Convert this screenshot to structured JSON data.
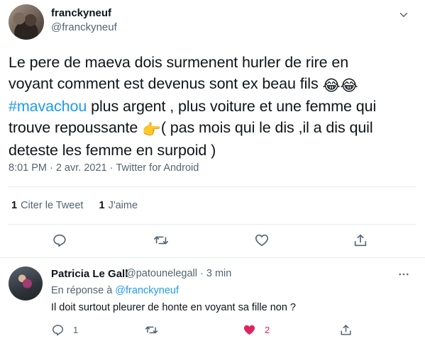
{
  "main_tweet": {
    "display_name": "franckyneuf",
    "handle": "@franckyneuf",
    "text_parts": {
      "line1": "Le pere de maeva dois surmenent hurler de rire en",
      "line2a": "voyant comment est devenus sont ex beau fils ",
      "emoji_laugh": "😂😂",
      "hashtag": "#mavachou",
      "line3b": " plus argent , plus voiture et une femme qui",
      "line4a": "trouve repoussante ",
      "emoji_point": "👉",
      "line4b": "( pas mois qui le dis ,il a dis quil",
      "line5": "deteste les femme en surpoid )"
    },
    "time": "8:01 PM",
    "date": "2 avr. 2021",
    "source": "Twitter for Android",
    "stats": {
      "retweets_count": "1",
      "retweets_label": "Citer le Tweet",
      "likes_count": "1",
      "likes_label": "J'aime"
    }
  },
  "reply": {
    "display_name": "Patricia Le Gall",
    "handle": "@patounelegall · 3 min",
    "replying_prefix": "En réponse à",
    "replying_to": "@franckyneuf",
    "text": "Il doit surtout pleurer de honte en voyant sa fille non ?",
    "reply_count": "1",
    "like_count": "2"
  },
  "icons": {
    "more": "chevron-down-icon",
    "reply": "reply-icon",
    "retweet": "retweet-icon",
    "like": "heart-icon",
    "share": "share-icon"
  },
  "colors": {
    "accent": "#1d9bf0",
    "text": "#0f1419",
    "muted": "#536471",
    "like_active": "#e0245e"
  }
}
